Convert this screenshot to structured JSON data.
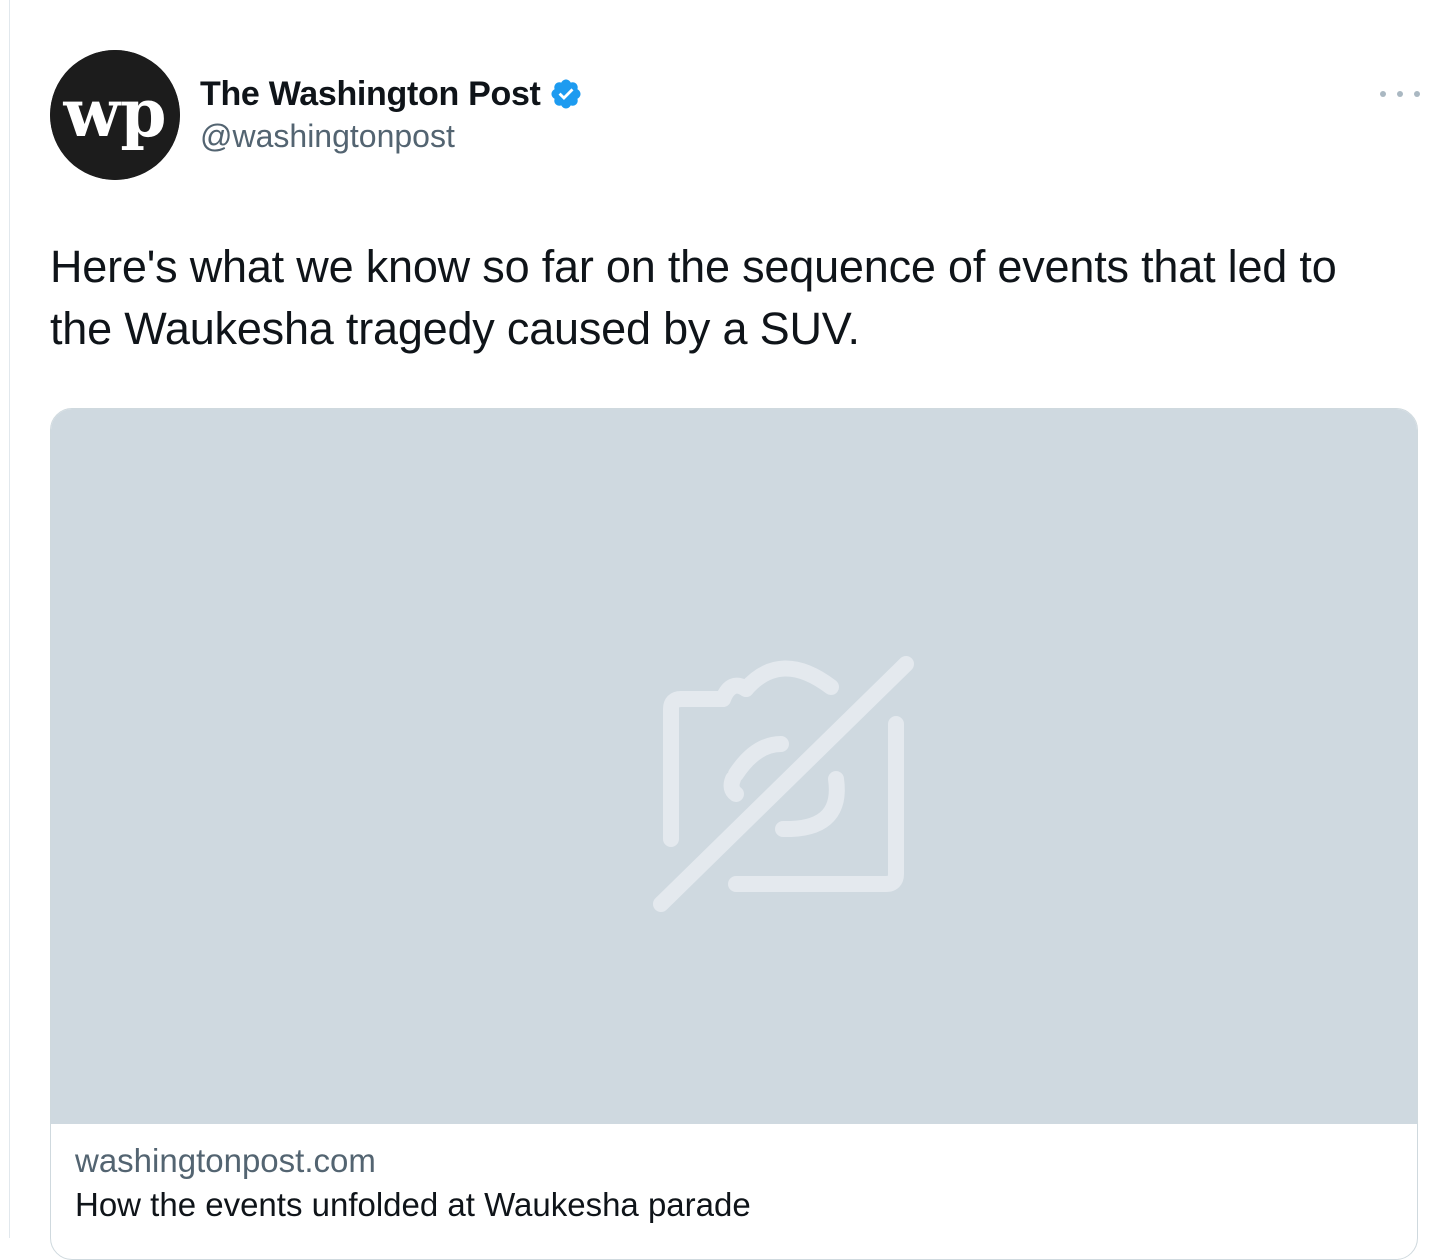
{
  "author": {
    "display_name": "The Washington Post",
    "handle": "@washingtonpost",
    "verified": true,
    "avatar_icon": "wp-logo-icon",
    "avatar_text": "wp"
  },
  "tweet": {
    "text": "Here's what we know so far on the sequence of events that led to the Waukesha tragedy caused by a SUV."
  },
  "link_card": {
    "domain": "washingtonpost.com",
    "title": "How the events unfolded at Waukesha parade",
    "media_icon": "image-unavailable-icon"
  },
  "menu": {
    "icon": "more-options-icon"
  },
  "colors": {
    "verified_blue": "#1d9bf0",
    "secondary_text": "#536471",
    "media_placeholder": "#cfd9e0",
    "border": "#cfd9de"
  }
}
